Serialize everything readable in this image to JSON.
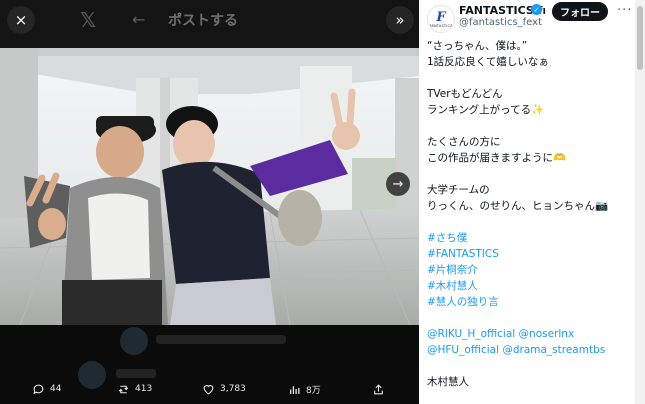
{
  "viewer": {
    "header_title": "ポストする",
    "back_glyph": "←",
    "x_logo": "𝕏",
    "close_icon": "×",
    "expand_icon": "»",
    "next_icon": "→"
  },
  "actions": {
    "replies": "44",
    "reposts": "413",
    "likes": "3,783",
    "views": "8万"
  },
  "account": {
    "display_name": "FANTASTICS fro",
    "handle": "@fantastics_fext",
    "follow_label": "フォロー",
    "more_label": "···",
    "avatar_letter": "F",
    "avatar_word": "FANTASTICS",
    "verified_icon": "✓"
  },
  "tweet": {
    "lines": [
      "“さっちゃん、僕は。”",
      "1話反応良くて嬉しいなぁ",
      "",
      "TVerもどんどん",
      "ランキング上がってる✨",
      "",
      "たくさんの方に",
      "この作品が届きますように🫶",
      "",
      "大学チームの",
      "りっくん、のせりん、ヒョンちゃん📷"
    ],
    "hashtags": [
      "#さち僕",
      "#FANTASTICS",
      "#片桐奈介",
      "#木村慧人",
      "#慧人の独り言"
    ],
    "mentions": [
      [
        "@RIKU_H_official",
        "@noserlnx"
      ],
      [
        "@HFU_official",
        "@drama_streamtbs"
      ]
    ],
    "signature": "木村慧人"
  },
  "colors": {
    "accent": "#1d9bf0",
    "text": "#0f1419",
    "muted": "#536471"
  }
}
